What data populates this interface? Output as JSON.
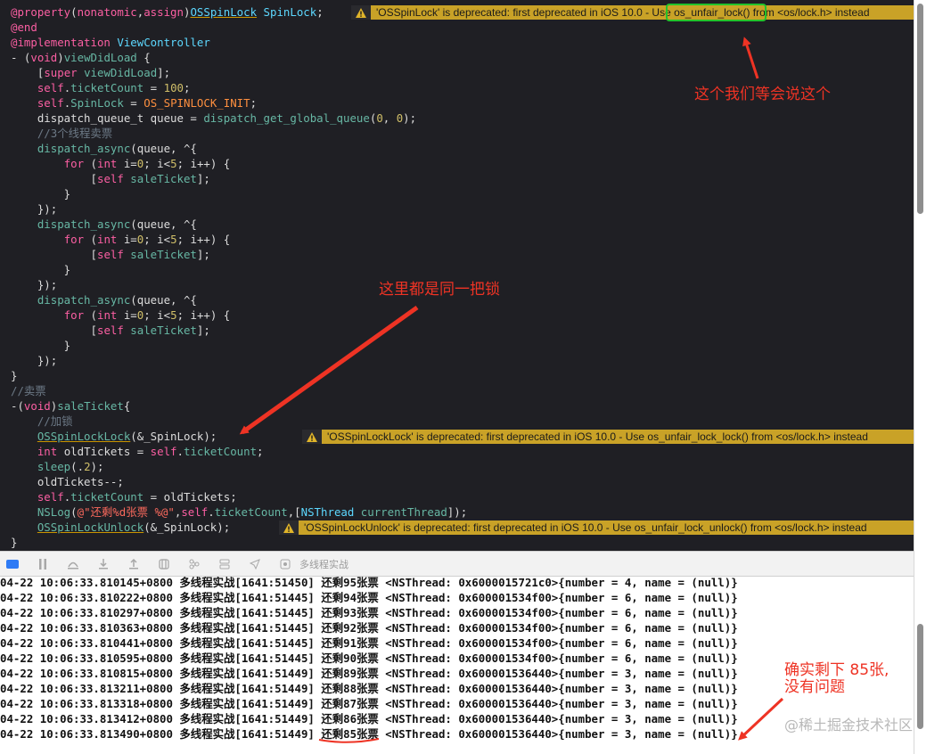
{
  "editor": {
    "lines": [
      [
        {
          "t": "@property",
          "c": "kw"
        },
        {
          "t": "(",
          "c": "plain"
        },
        {
          "t": "nonatomic",
          "c": "kw"
        },
        {
          "t": ",",
          "c": "plain"
        },
        {
          "t": "assign",
          "c": "kw"
        },
        {
          "t": ")",
          "c": "plain"
        },
        {
          "t": "OSSpinLock",
          "c": "cls dep"
        },
        {
          "t": " ",
          "c": "plain"
        },
        {
          "t": "SpinLock",
          "c": "cls"
        },
        {
          "t": ";",
          "c": "plain"
        }
      ],
      [
        {
          "t": "@end",
          "c": "kw"
        }
      ],
      [
        {
          "t": "@implementation",
          "c": "kw"
        },
        {
          "t": " ",
          "c": "plain"
        },
        {
          "t": "ViewController",
          "c": "cls"
        }
      ],
      [
        {
          "t": "- (",
          "c": "plain"
        },
        {
          "t": "void",
          "c": "kw"
        },
        {
          "t": ")",
          "c": "plain"
        },
        {
          "t": "viewDidLoad",
          "c": "fn"
        },
        {
          "t": " {",
          "c": "plain"
        }
      ],
      [
        {
          "t": "    [",
          "c": "plain"
        },
        {
          "t": "super",
          "c": "kw"
        },
        {
          "t": " ",
          "c": "plain"
        },
        {
          "t": "viewDidLoad",
          "c": "fn"
        },
        {
          "t": "];",
          "c": "plain"
        }
      ],
      [
        {
          "t": "    ",
          "c": "plain"
        },
        {
          "t": "self",
          "c": "kw"
        },
        {
          "t": ".",
          "c": "plain"
        },
        {
          "t": "ticketCount",
          "c": "fn"
        },
        {
          "t": " = ",
          "c": "plain"
        },
        {
          "t": "100",
          "c": "num"
        },
        {
          "t": ";",
          "c": "plain"
        }
      ],
      [
        {
          "t": "    ",
          "c": "plain"
        },
        {
          "t": "self",
          "c": "kw"
        },
        {
          "t": ".",
          "c": "plain"
        },
        {
          "t": "SpinLock",
          "c": "fn"
        },
        {
          "t": " = ",
          "c": "plain"
        },
        {
          "t": "OS_SPINLOCK_INIT",
          "c": "pre"
        },
        {
          "t": ";",
          "c": "plain"
        }
      ],
      [
        {
          "t": "    dispatch_queue_t queue = ",
          "c": "plain"
        },
        {
          "t": "dispatch_get_global_queue",
          "c": "fn"
        },
        {
          "t": "(",
          "c": "plain"
        },
        {
          "t": "0",
          "c": "num"
        },
        {
          "t": ", ",
          "c": "plain"
        },
        {
          "t": "0",
          "c": "num"
        },
        {
          "t": ");",
          "c": "plain"
        }
      ],
      [
        {
          "t": "    //3个线程卖票",
          "c": "cmt"
        }
      ],
      [
        {
          "t": "    ",
          "c": "plain"
        },
        {
          "t": "dispatch_async",
          "c": "fn"
        },
        {
          "t": "(queue, ^{",
          "c": "plain"
        }
      ],
      [
        {
          "t": "        ",
          "c": "plain"
        },
        {
          "t": "for",
          "c": "kw"
        },
        {
          "t": " (",
          "c": "plain"
        },
        {
          "t": "int",
          "c": "kw"
        },
        {
          "t": " i=",
          "c": "plain"
        },
        {
          "t": "0",
          "c": "num"
        },
        {
          "t": "; i<",
          "c": "plain"
        },
        {
          "t": "5",
          "c": "num"
        },
        {
          "t": "; i++) {",
          "c": "plain"
        }
      ],
      [
        {
          "t": "            [",
          "c": "plain"
        },
        {
          "t": "self",
          "c": "kw"
        },
        {
          "t": " ",
          "c": "plain"
        },
        {
          "t": "saleTicket",
          "c": "fn"
        },
        {
          "t": "];",
          "c": "plain"
        }
      ],
      [
        {
          "t": "        }",
          "c": "plain"
        }
      ],
      [
        {
          "t": "    });",
          "c": "plain"
        }
      ],
      [
        {
          "t": "    ",
          "c": "plain"
        },
        {
          "t": "dispatch_async",
          "c": "fn"
        },
        {
          "t": "(queue, ^{",
          "c": "plain"
        }
      ],
      [
        {
          "t": "        ",
          "c": "plain"
        },
        {
          "t": "for",
          "c": "kw"
        },
        {
          "t": " (",
          "c": "plain"
        },
        {
          "t": "int",
          "c": "kw"
        },
        {
          "t": " i=",
          "c": "plain"
        },
        {
          "t": "0",
          "c": "num"
        },
        {
          "t": "; i<",
          "c": "plain"
        },
        {
          "t": "5",
          "c": "num"
        },
        {
          "t": "; i++) {",
          "c": "plain"
        }
      ],
      [
        {
          "t": "            [",
          "c": "plain"
        },
        {
          "t": "self",
          "c": "kw"
        },
        {
          "t": " ",
          "c": "plain"
        },
        {
          "t": "saleTicket",
          "c": "fn"
        },
        {
          "t": "];",
          "c": "plain"
        }
      ],
      [
        {
          "t": "        }",
          "c": "plain"
        }
      ],
      [
        {
          "t": "    });",
          "c": "plain"
        }
      ],
      [
        {
          "t": "    ",
          "c": "plain"
        },
        {
          "t": "dispatch_async",
          "c": "fn"
        },
        {
          "t": "(queue, ^{",
          "c": "plain"
        }
      ],
      [
        {
          "t": "        ",
          "c": "plain"
        },
        {
          "t": "for",
          "c": "kw"
        },
        {
          "t": " (",
          "c": "plain"
        },
        {
          "t": "int",
          "c": "kw"
        },
        {
          "t": " i=",
          "c": "plain"
        },
        {
          "t": "0",
          "c": "num"
        },
        {
          "t": "; i<",
          "c": "plain"
        },
        {
          "t": "5",
          "c": "num"
        },
        {
          "t": "; i++) {",
          "c": "plain"
        }
      ],
      [
        {
          "t": "            [",
          "c": "plain"
        },
        {
          "t": "self",
          "c": "kw"
        },
        {
          "t": " ",
          "c": "plain"
        },
        {
          "t": "saleTicket",
          "c": "fn"
        },
        {
          "t": "];",
          "c": "plain"
        }
      ],
      [
        {
          "t": "        }",
          "c": "plain"
        }
      ],
      [
        {
          "t": "    });",
          "c": "plain"
        }
      ],
      [
        {
          "t": "}",
          "c": "plain"
        }
      ],
      [
        {
          "t": "//卖票",
          "c": "cmt"
        }
      ],
      [
        {
          "t": "-(",
          "c": "plain"
        },
        {
          "t": "void",
          "c": "kw"
        },
        {
          "t": ")",
          "c": "plain"
        },
        {
          "t": "saleTicket",
          "c": "fn"
        },
        {
          "t": "{",
          "c": "plain"
        }
      ],
      [
        {
          "t": "    //加锁",
          "c": "cmt"
        }
      ],
      [
        {
          "t": "    ",
          "c": "plain"
        },
        {
          "t": "OSSpinLockLock",
          "c": "fn dep"
        },
        {
          "t": "(&_SpinLock);",
          "c": "plain"
        }
      ],
      [
        {
          "t": "    ",
          "c": "plain"
        },
        {
          "t": "int",
          "c": "kw"
        },
        {
          "t": " oldTickets = ",
          "c": "plain"
        },
        {
          "t": "self",
          "c": "kw"
        },
        {
          "t": ".",
          "c": "plain"
        },
        {
          "t": "ticketCount",
          "c": "fn"
        },
        {
          "t": ";",
          "c": "plain"
        }
      ],
      [
        {
          "t": "    ",
          "c": "plain"
        },
        {
          "t": "sleep",
          "c": "fn"
        },
        {
          "t": "(.",
          "c": "plain"
        },
        {
          "t": "2",
          "c": "num"
        },
        {
          "t": ");",
          "c": "plain"
        }
      ],
      [
        {
          "t": "    oldTickets--;",
          "c": "plain"
        }
      ],
      [
        {
          "t": "    ",
          "c": "plain"
        },
        {
          "t": "self",
          "c": "kw"
        },
        {
          "t": ".",
          "c": "plain"
        },
        {
          "t": "ticketCount",
          "c": "fn"
        },
        {
          "t": " = oldTickets;",
          "c": "plain"
        }
      ],
      [
        {
          "t": "    ",
          "c": "plain"
        },
        {
          "t": "NSLog",
          "c": "fn"
        },
        {
          "t": "(",
          "c": "plain"
        },
        {
          "t": "@\"还剩%d张票 %@\"",
          "c": "str"
        },
        {
          "t": ",",
          "c": "plain"
        },
        {
          "t": "self",
          "c": "kw"
        },
        {
          "t": ".",
          "c": "plain"
        },
        {
          "t": "ticketCount",
          "c": "fn"
        },
        {
          "t": ",[",
          "c": "plain"
        },
        {
          "t": "NSThread",
          "c": "cls"
        },
        {
          "t": " ",
          "c": "plain"
        },
        {
          "t": "currentThread",
          "c": "fn"
        },
        {
          "t": "]);",
          "c": "plain"
        }
      ],
      [
        {
          "t": "    ",
          "c": "plain"
        },
        {
          "t": "OSSpinLockUnlock",
          "c": "fn dep"
        },
        {
          "t": "(&_SpinLock);",
          "c": "plain"
        }
      ],
      [
        {
          "t": "}",
          "c": "plain"
        }
      ]
    ],
    "warnings": [
      {
        "text": "'OSSpinLock' is deprecated: first deprecated in iOS 10.0 - Use os_unfair_lock() from <os/lock.h> instead",
        "line": 0
      },
      {
        "text": "'OSSpinLockLock' is deprecated: first deprecated in iOS 10.0 - Use os_unfair_lock_lock() from <os/lock.h> instead",
        "line": 28
      },
      {
        "text": "'OSSpinLockUnlock' is deprecated: first deprecated in iOS 10.0 - Use os_unfair_lock_unlock() from <os/lock.h> instead",
        "line": 34
      }
    ]
  },
  "toolbar": {
    "icons": [
      "console-toggle-icon",
      "pause-icon",
      "step-over-icon",
      "step-in-icon",
      "step-out-icon",
      "view-hierarchy-icon",
      "memory-graph-icon",
      "environment-icon",
      "location-icon",
      "process-icon"
    ],
    "process_label": "多线程实战"
  },
  "console": {
    "lines": [
      "04-22 10:06:33.810145+0800 多线程实战[1641:51450] 还剩95张票 <NSThread: 0x6000015721c0>{number = 4, name = (null)}",
      "04-22 10:06:33.810222+0800 多线程实战[1641:51445] 还剩94张票 <NSThread: 0x600001534f00>{number = 6, name = (null)}",
      "04-22 10:06:33.810297+0800 多线程实战[1641:51445] 还剩93张票 <NSThread: 0x600001534f00>{number = 6, name = (null)}",
      "04-22 10:06:33.810363+0800 多线程实战[1641:51445] 还剩92张票 <NSThread: 0x600001534f00>{number = 6, name = (null)}",
      "04-22 10:06:33.810441+0800 多线程实战[1641:51445] 还剩91张票 <NSThread: 0x600001534f00>{number = 6, name = (null)}",
      "04-22 10:06:33.810595+0800 多线程实战[1641:51445] 还剩90张票 <NSThread: 0x600001534f00>{number = 6, name = (null)}",
      "04-22 10:06:33.810815+0800 多线程实战[1641:51449] 还剩89张票 <NSThread: 0x600001536440>{number = 3, name = (null)}",
      "04-22 10:06:33.813211+0800 多线程实战[1641:51449] 还剩88张票 <NSThread: 0x600001536440>{number = 3, name = (null)}",
      "04-22 10:06:33.813318+0800 多线程实战[1641:51449] 还剩87张票 <NSThread: 0x600001536440>{number = 3, name = (null)}",
      "04-22 10:06:33.813412+0800 多线程实战[1641:51449] 还剩86张票 <NSThread: 0x600001536440>{number = 3, name = (null)}",
      "04-22 10:06:33.813490+0800 多线程实战[1641:51449] 还剩85张票 <NSThread: 0x600001536440>{number = 3, name = (null)}"
    ]
  },
  "annotations": {
    "top": "这个我们等会说这个",
    "middle": "这里都是同一把锁",
    "bottom_line1": "确实剩下 85张,",
    "bottom_line2": "没有问题",
    "color": "#ee3324"
  },
  "watermark": "@稀土掘金技术社区",
  "colors": {
    "editor_bg": "#1f1f24",
    "warning_bg": "#c9a227",
    "highlight_box": "#22c32a"
  }
}
